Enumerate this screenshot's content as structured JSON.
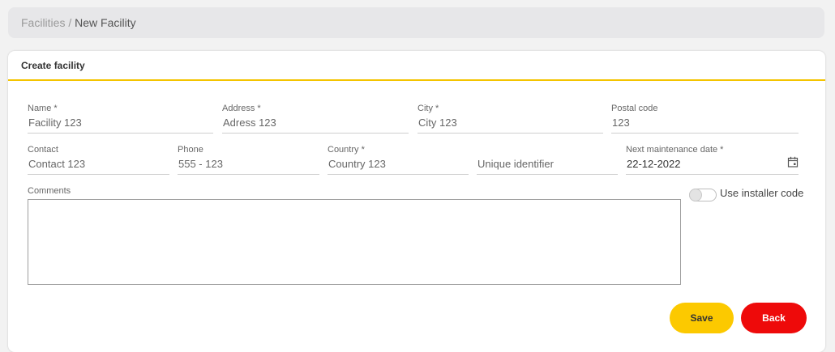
{
  "breadcrumb": {
    "parent": "Facilities",
    "separator": " / ",
    "current": "New Facility"
  },
  "card": {
    "title": "Create facility"
  },
  "form": {
    "name": {
      "label": "Name *",
      "value": "Facility 123"
    },
    "address": {
      "label": "Address *",
      "value": "Adress 123"
    },
    "city": {
      "label": "City *",
      "value": "City 123"
    },
    "postal_code": {
      "label": "Postal code",
      "value": "123"
    },
    "contact": {
      "label": "Contact",
      "value": "Contact 123"
    },
    "phone": {
      "label": "Phone",
      "value": "555 - 123"
    },
    "country": {
      "label": "Country *",
      "value": "Country 123"
    },
    "unique_identifier": {
      "placeholder": "Unique identifier"
    },
    "next_maintenance": {
      "label": "Next maintenance date *",
      "value": "22-12-2022"
    },
    "comments": {
      "label": "Comments",
      "value": ""
    },
    "installer_toggle": {
      "label": "Use installer code",
      "checked": false
    }
  },
  "buttons": {
    "save": "Save",
    "back": "Back"
  },
  "colors": {
    "accent": "#fcc900",
    "danger": "#ee0a0a",
    "header_underline": "#f4c400"
  }
}
